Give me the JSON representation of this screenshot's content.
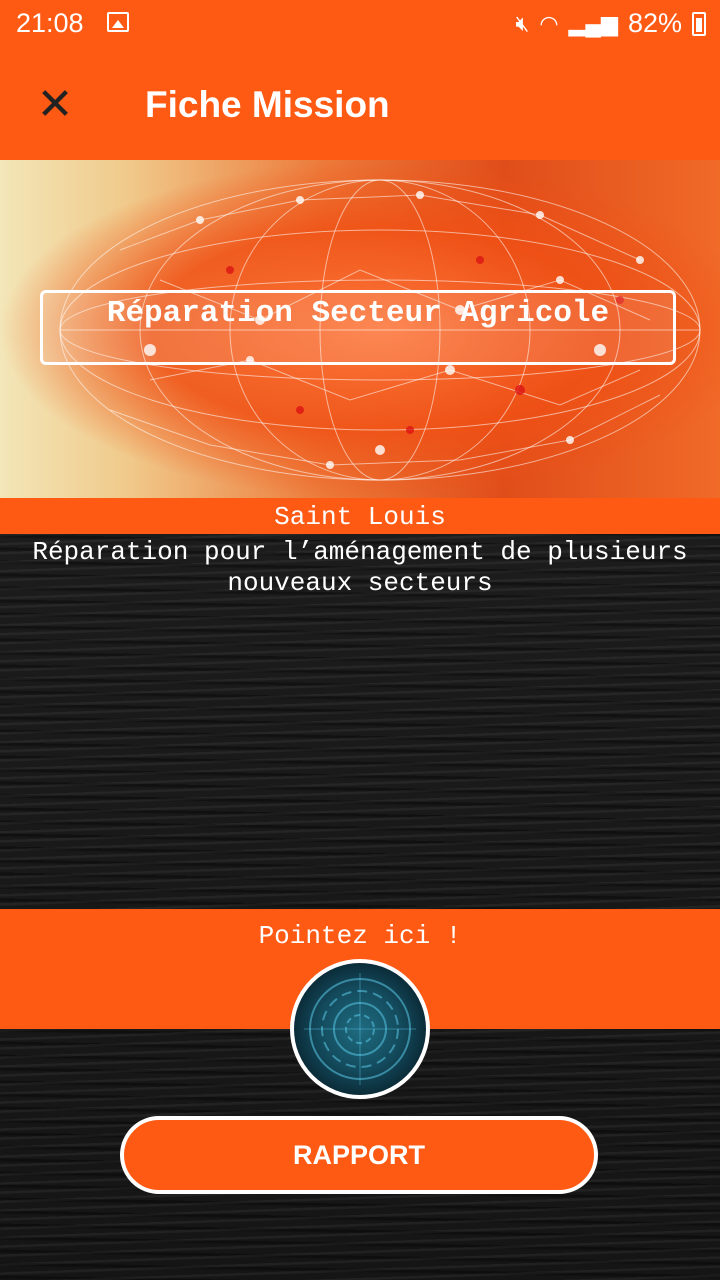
{
  "status_bar": {
    "time": "21:08",
    "battery": "82%",
    "icons": [
      "image-icon",
      "mute-icon",
      "wifi-icon",
      "signal-icon",
      "battery-charging-icon"
    ]
  },
  "app_bar": {
    "close_icon": "close-icon",
    "title": "Fiche Mission"
  },
  "mission": {
    "title": "Réparation Secteur Agricole",
    "location": "Saint Louis",
    "description": "Réparation pour l’aménagement de plusieurs nouveaux secteurs"
  },
  "pointage": {
    "label": "Pointez ici !",
    "icon": "fingerprint-scan-icon"
  },
  "actions": {
    "rapport_label": "RAPPORT"
  },
  "colors": {
    "accent": "#FF5A14",
    "background": "#151515",
    "text": "#FFFFFF"
  }
}
